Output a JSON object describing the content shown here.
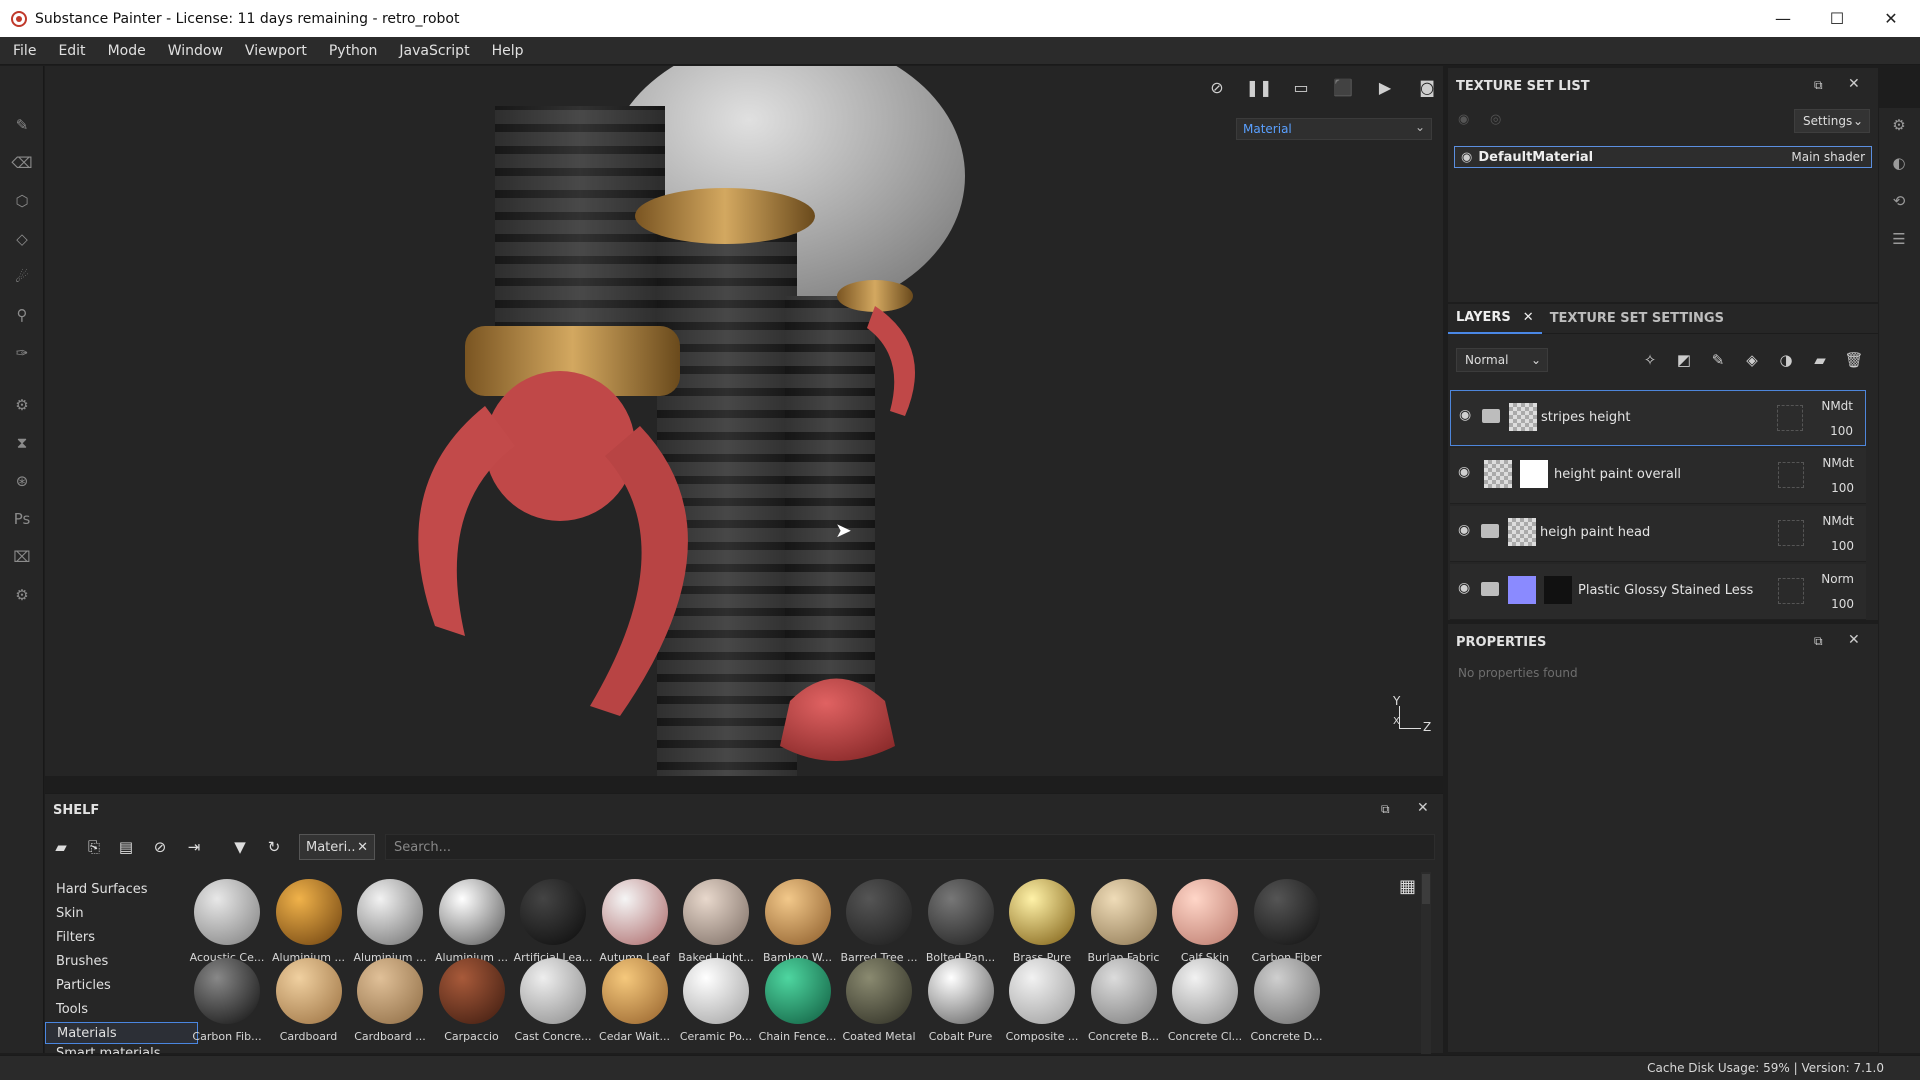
{
  "window": {
    "title": "Substance Painter - License: 11 days remaining - retro_robot",
    "minimize": "—",
    "maximize": "☐",
    "close": "✕"
  },
  "menu": [
    "File",
    "Edit",
    "Mode",
    "Window",
    "Viewport",
    "Python",
    "JavaScript",
    "Help"
  ],
  "viewport": {
    "mode_select": "Material",
    "axis_y": "Y",
    "axis_x": "X",
    "axis_z": "Z"
  },
  "texture_set_list": {
    "title": "TEXTURE SET LIST",
    "settings_label": "Settings",
    "material_name": "DefaultMaterial",
    "shader": "Main shader"
  },
  "layers_panel": {
    "tabs": [
      "LAYERS",
      "TEXTURE SET SETTINGS"
    ],
    "blend_mode": "Normal",
    "layers": [
      {
        "name": "stripes height",
        "blend": "NMdt",
        "opacity": "100"
      },
      {
        "name": "height paint overall",
        "blend": "NMdt",
        "opacity": "100"
      },
      {
        "name": "heigh paint head",
        "blend": "NMdt",
        "opacity": "100"
      },
      {
        "name": "Plastic Glossy Stained Less",
        "blend": "Norm",
        "opacity": "100"
      }
    ]
  },
  "properties": {
    "title": "PROPERTIES",
    "empty": "No properties found"
  },
  "shelf": {
    "title": "SHELF",
    "filter_tag": "Materi..",
    "search_placeholder": "Search...",
    "categories": [
      "Hard Surfaces",
      "Skin",
      "Filters",
      "Brushes",
      "Particles",
      "Tools",
      "Materials",
      "Smart materials"
    ],
    "active_category": "Materials",
    "materials_row1": [
      "Acoustic Ce...",
      "Aluminium ...",
      "Aluminium ...",
      "Aluminium ...",
      "Artificial Lea...",
      "Autumn Leaf",
      "Baked Light...",
      "Bamboo W...",
      "Barred Tree ...",
      "Bolted Pan...",
      "Brass Pure",
      "Burlap Fabric",
      "Calf Skin",
      "Carbon Fiber"
    ],
    "materials_row2": [
      "Carbon Fib...",
      "Cardboard",
      "Cardboard ...",
      "Carpaccio",
      "Cast Concre...",
      "Cedar Wait...",
      "Ceramic Po...",
      "Chain Fence...",
      "Coated Metal",
      "Cobalt Pure",
      "Composite ...",
      "Concrete B...",
      "Concrete Cl...",
      "Concrete D..."
    ]
  },
  "status": {
    "text": "Cache Disk Usage:   59% | Version: 7.1.0"
  },
  "colors": {
    "accent": "#4a88e6",
    "panel_bg": "#262626",
    "red_part": "#c94a4a",
    "gold": "#b8883a"
  }
}
